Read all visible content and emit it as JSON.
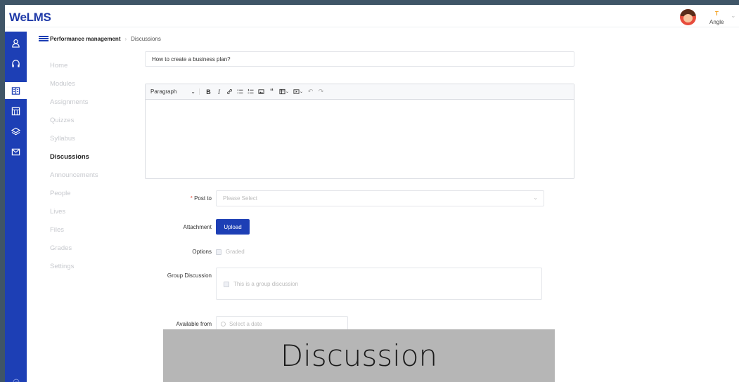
{
  "app": {
    "title": "WeLMS"
  },
  "user": {
    "initial": "T",
    "name": "Angle",
    "avatar_icon": "user-avatar"
  },
  "iconbar": {
    "color": "#1d3fb5",
    "icons": [
      "user-icon",
      "headphones-icon",
      "book-icon",
      "calendar-grid-icon",
      "layers-icon",
      "mail-icon"
    ],
    "bottom_icon": "logout-icon"
  },
  "breadcrumb": {
    "course": "Performance management",
    "page": "Discussions"
  },
  "nav": {
    "items": [
      {
        "label": "Home"
      },
      {
        "label": "Modules"
      },
      {
        "label": "Assignments"
      },
      {
        "label": "Quizzes"
      },
      {
        "label": "Syllabus"
      },
      {
        "label": "Discussions",
        "active": true
      },
      {
        "label": "Announcements"
      },
      {
        "label": "People"
      },
      {
        "label": "Lives"
      },
      {
        "label": "Files"
      },
      {
        "label": "Grades"
      },
      {
        "label": "Settings"
      }
    ]
  },
  "form": {
    "title_value": "How to create a business plan?",
    "editor": {
      "paragraph_label": "Paragraph",
      "tools": [
        "bold-icon",
        "italic-icon",
        "link-icon",
        "bulleted-list-icon",
        "numbered-list-icon",
        "image-icon",
        "quote-icon",
        "table-icon",
        "media-icon",
        "undo-icon",
        "redo-icon"
      ]
    },
    "post_to": {
      "label": "Post to",
      "required_mark": "*",
      "placeholder": "Please Select"
    },
    "attachment": {
      "label": "Attachment",
      "button": "Upload"
    },
    "options": {
      "label": "Options",
      "checkbox_label": "Graded"
    },
    "group": {
      "label": "Group Discussion",
      "checkbox_label": "This is a group discussion"
    },
    "available_from": {
      "label": "Available from",
      "placeholder": "Select a date"
    }
  },
  "caption": {
    "text": "Discussion"
  }
}
